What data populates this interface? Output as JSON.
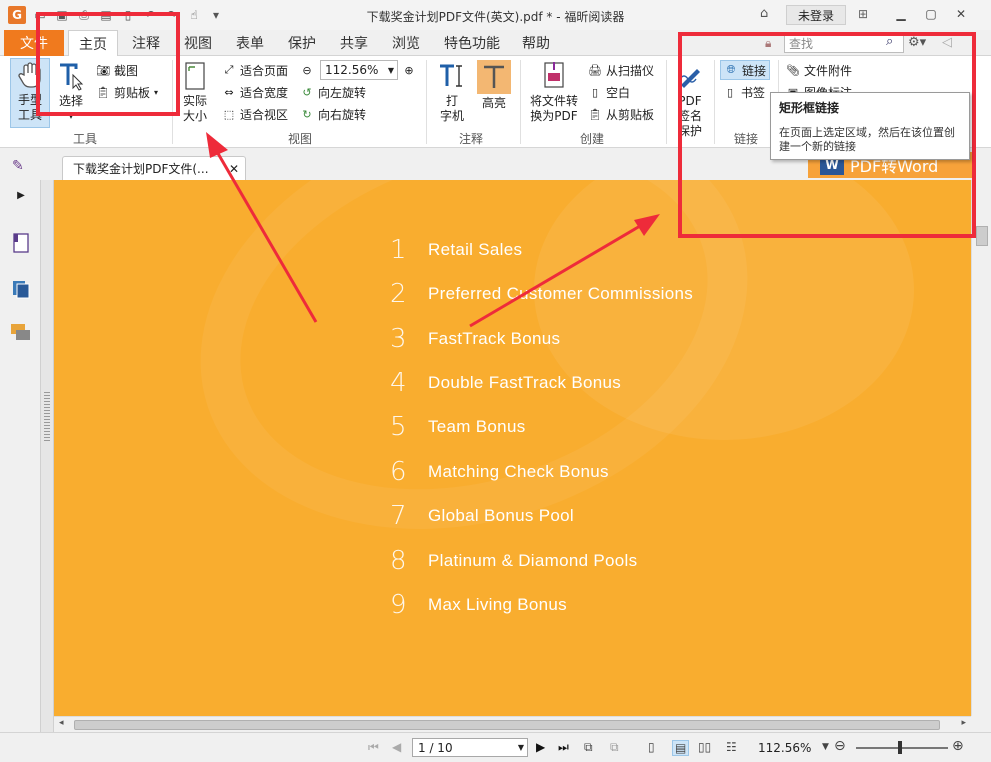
{
  "window": {
    "title": "下载奖金计划PDF文件(英文).pdf * - 福昕阅读器",
    "login_label": "未登录"
  },
  "menu_tabs": [
    {
      "label": "文件"
    },
    {
      "label": "主页"
    },
    {
      "label": "注释"
    },
    {
      "label": "视图"
    },
    {
      "label": "表单"
    },
    {
      "label": "保护"
    },
    {
      "label": "共享"
    },
    {
      "label": "浏览"
    },
    {
      "label": "特色功能"
    },
    {
      "label": "帮助"
    }
  ],
  "search": {
    "placeholder": "查找"
  },
  "ribbon": {
    "tools": {
      "hand_line1": "手型",
      "hand_line2": "工具",
      "select_label": "选择",
      "screenshot_label": "截图",
      "clipboard_label": "剪贴板",
      "group_label": "工具"
    },
    "view": {
      "actual_size_line1": "实际",
      "actual_size_line2": "大小",
      "fit_page": "适合页面",
      "fit_width": "适合宽度",
      "fit_visible": "适合视区",
      "zoom_value": "112.56%",
      "rotate_left": "向左旋转",
      "rotate_right": "向右旋转",
      "group_label": "视图"
    },
    "annotate": {
      "typewriter_line1": "打",
      "typewriter_line2": "字机",
      "highlight": "高亮",
      "group_label": "注释"
    },
    "create": {
      "convert_line1": "将文件转",
      "convert_line2": "换为PDF",
      "from_scanner": "从扫描仪",
      "blank": "空白",
      "from_clipboard": "从剪贴板",
      "group_label": "创建"
    },
    "protect": {
      "sign_line1": "PDF",
      "sign_line2": "签名",
      "sign_line3": "保护"
    },
    "links": {
      "link": "链接",
      "bookmark": "书签",
      "group_label": "链接"
    },
    "insert": {
      "attachment": "文件附件",
      "image_annot": "图像标注"
    }
  },
  "tooltip": {
    "title": "矩形框链接",
    "body": "在页面上选定区域，然后在该位置创建一个新的链接"
  },
  "doc_tab": {
    "label": "下载奖金计划PDF文件(..."
  },
  "promo": {
    "label": "PDF转Word"
  },
  "pdf_page": {
    "items": [
      {
        "num": "1",
        "text": "Retail Sales"
      },
      {
        "num": "2",
        "text": "Preferred Customer Commissions"
      },
      {
        "num": "3",
        "text": "FastTrack Bonus"
      },
      {
        "num": "4",
        "text": "Double FastTrack Bonus"
      },
      {
        "num": "5",
        "text": "Team Bonus"
      },
      {
        "num": "6",
        "text": "Matching Check Bonus"
      },
      {
        "num": "7",
        "text": "Global Bonus Pool"
      },
      {
        "num": "8",
        "text": "Platinum & Diamond Pools"
      },
      {
        "num": "9",
        "text": "Max Living Bonus"
      }
    ]
  },
  "status": {
    "page_indicator": "1 / 10",
    "zoom": "112.56%"
  }
}
